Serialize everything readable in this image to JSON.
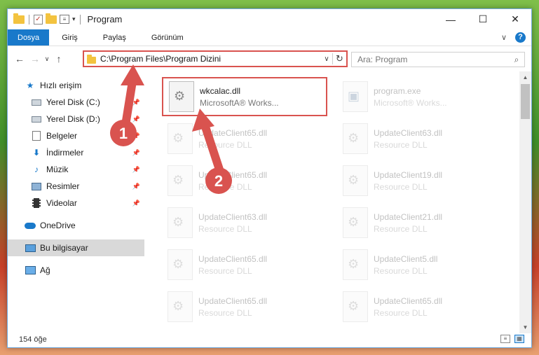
{
  "window": {
    "title": "Program",
    "controls": {
      "minimize": "—",
      "maximize": "☐",
      "close": "✕"
    }
  },
  "ribbon": {
    "tabs": [
      "Dosya",
      "Giriş",
      "Paylaş",
      "Görünüm"
    ],
    "expand": "∨",
    "help": "?"
  },
  "address": {
    "path": "C:\\Program Files\\Program Dizini",
    "dropdown": "∨",
    "refresh": "↻"
  },
  "search": {
    "placeholder": "Ara: Program"
  },
  "sidebar": {
    "quick_access": "Hızlı erişim",
    "items": [
      {
        "label": "Yerel Disk (C:)",
        "icon": "disk-icon"
      },
      {
        "label": "Yerel Disk (D:)",
        "icon": "disk-icon"
      },
      {
        "label": "Belgeler",
        "icon": "documents-icon"
      },
      {
        "label": "İndirmeler",
        "icon": "downloads-icon"
      },
      {
        "label": "Müzik",
        "icon": "music-icon"
      },
      {
        "label": "Resimler",
        "icon": "pictures-icon"
      },
      {
        "label": "Videolar",
        "icon": "videos-icon"
      }
    ],
    "onedrive": "OneDrive",
    "this_pc": "Bu bilgisayar",
    "network": "Ağ"
  },
  "files": [
    {
      "name": "wkcalac.dll",
      "desc": "MicrosoftA® Works...",
      "faded": false
    },
    {
      "name": "program.exe",
      "desc": "Microsoft® Works...",
      "faded": true
    },
    {
      "name": "UpdateClient65.dll",
      "desc": "Resource DLL",
      "faded": true
    },
    {
      "name": "UpdateClient63.dll",
      "desc": "Resource DLL",
      "faded": true
    },
    {
      "name": "UpdateClient65.dll",
      "desc": "Resource DLL",
      "faded": true
    },
    {
      "name": "UpdateClient19.dll",
      "desc": "Resource DLL",
      "faded": true
    },
    {
      "name": "UpdateClient63.dll",
      "desc": "Resource DLL",
      "faded": true
    },
    {
      "name": "UpdateClient21.dll",
      "desc": "Resource DLL",
      "faded": true
    },
    {
      "name": "UpdateClient65.dll",
      "desc": "Resource DLL",
      "faded": true
    },
    {
      "name": "UpdateClient5.dll",
      "desc": "Resource DLL",
      "faded": true
    },
    {
      "name": "UpdateClient65.dll",
      "desc": "Resource DLL",
      "faded": true
    },
    {
      "name": "UpdateClient65.dll",
      "desc": "Resource DLL",
      "faded": true
    }
  ],
  "status": {
    "count": "154 öğe"
  },
  "annotations": {
    "step1": "1",
    "step2": "2",
    "color": "#d9534f"
  }
}
